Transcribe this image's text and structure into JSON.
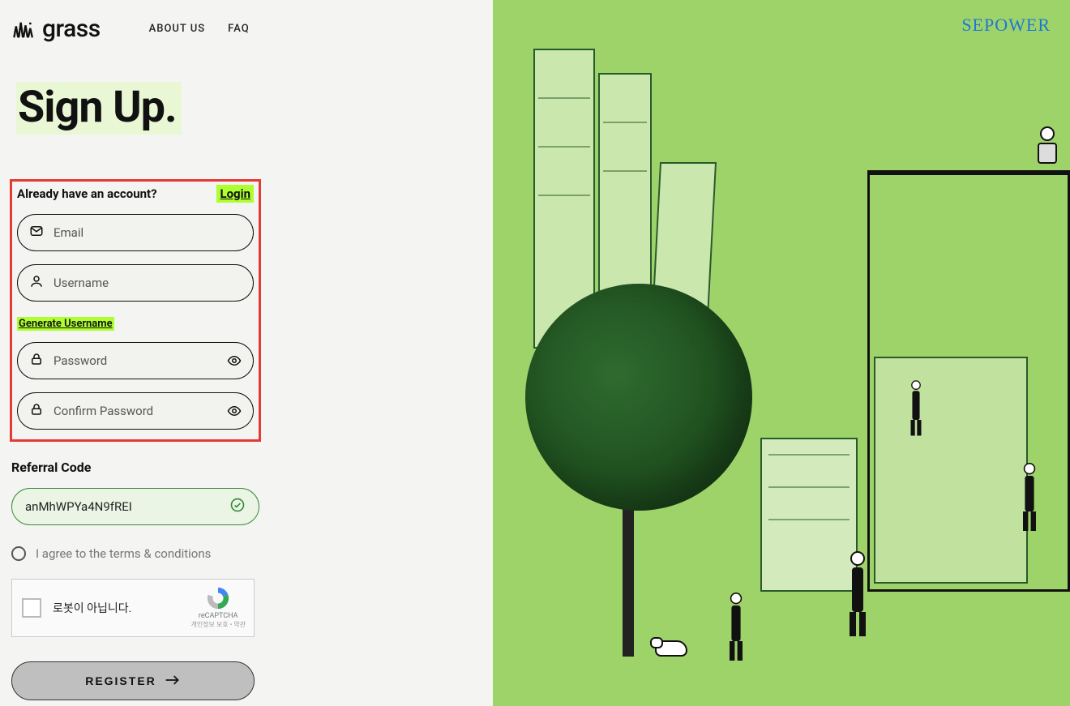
{
  "brand": {
    "name": "grass"
  },
  "nav": {
    "about": "ABOUT US",
    "faq": "FAQ"
  },
  "page": {
    "title": "Sign Up."
  },
  "form": {
    "already_text": "Already have an account?",
    "login_label": "Login",
    "email_placeholder": "Email",
    "username_placeholder": "Username",
    "generate_username": "Generate Username",
    "password_placeholder": "Password",
    "confirm_password_placeholder": "Confirm Password"
  },
  "referral": {
    "label": "Referral Code",
    "value": "anMhWPYa4N9fREI"
  },
  "terms": {
    "text": "I agree to the terms & conditions"
  },
  "captcha": {
    "text": "로봇이 아닙니다.",
    "brand": "reCAPTCHA",
    "legal": "개인정보 보호 • 약관"
  },
  "register": {
    "label": "REGISTER"
  },
  "watermark": {
    "text": "SEPOWER"
  },
  "colors": {
    "highlight_green": "#adff2f",
    "annotation_red": "#e53935",
    "illustration_bg": "#9ed36a",
    "referral_border": "#3a8a3a",
    "watermark_blue": "#1f77d4"
  }
}
